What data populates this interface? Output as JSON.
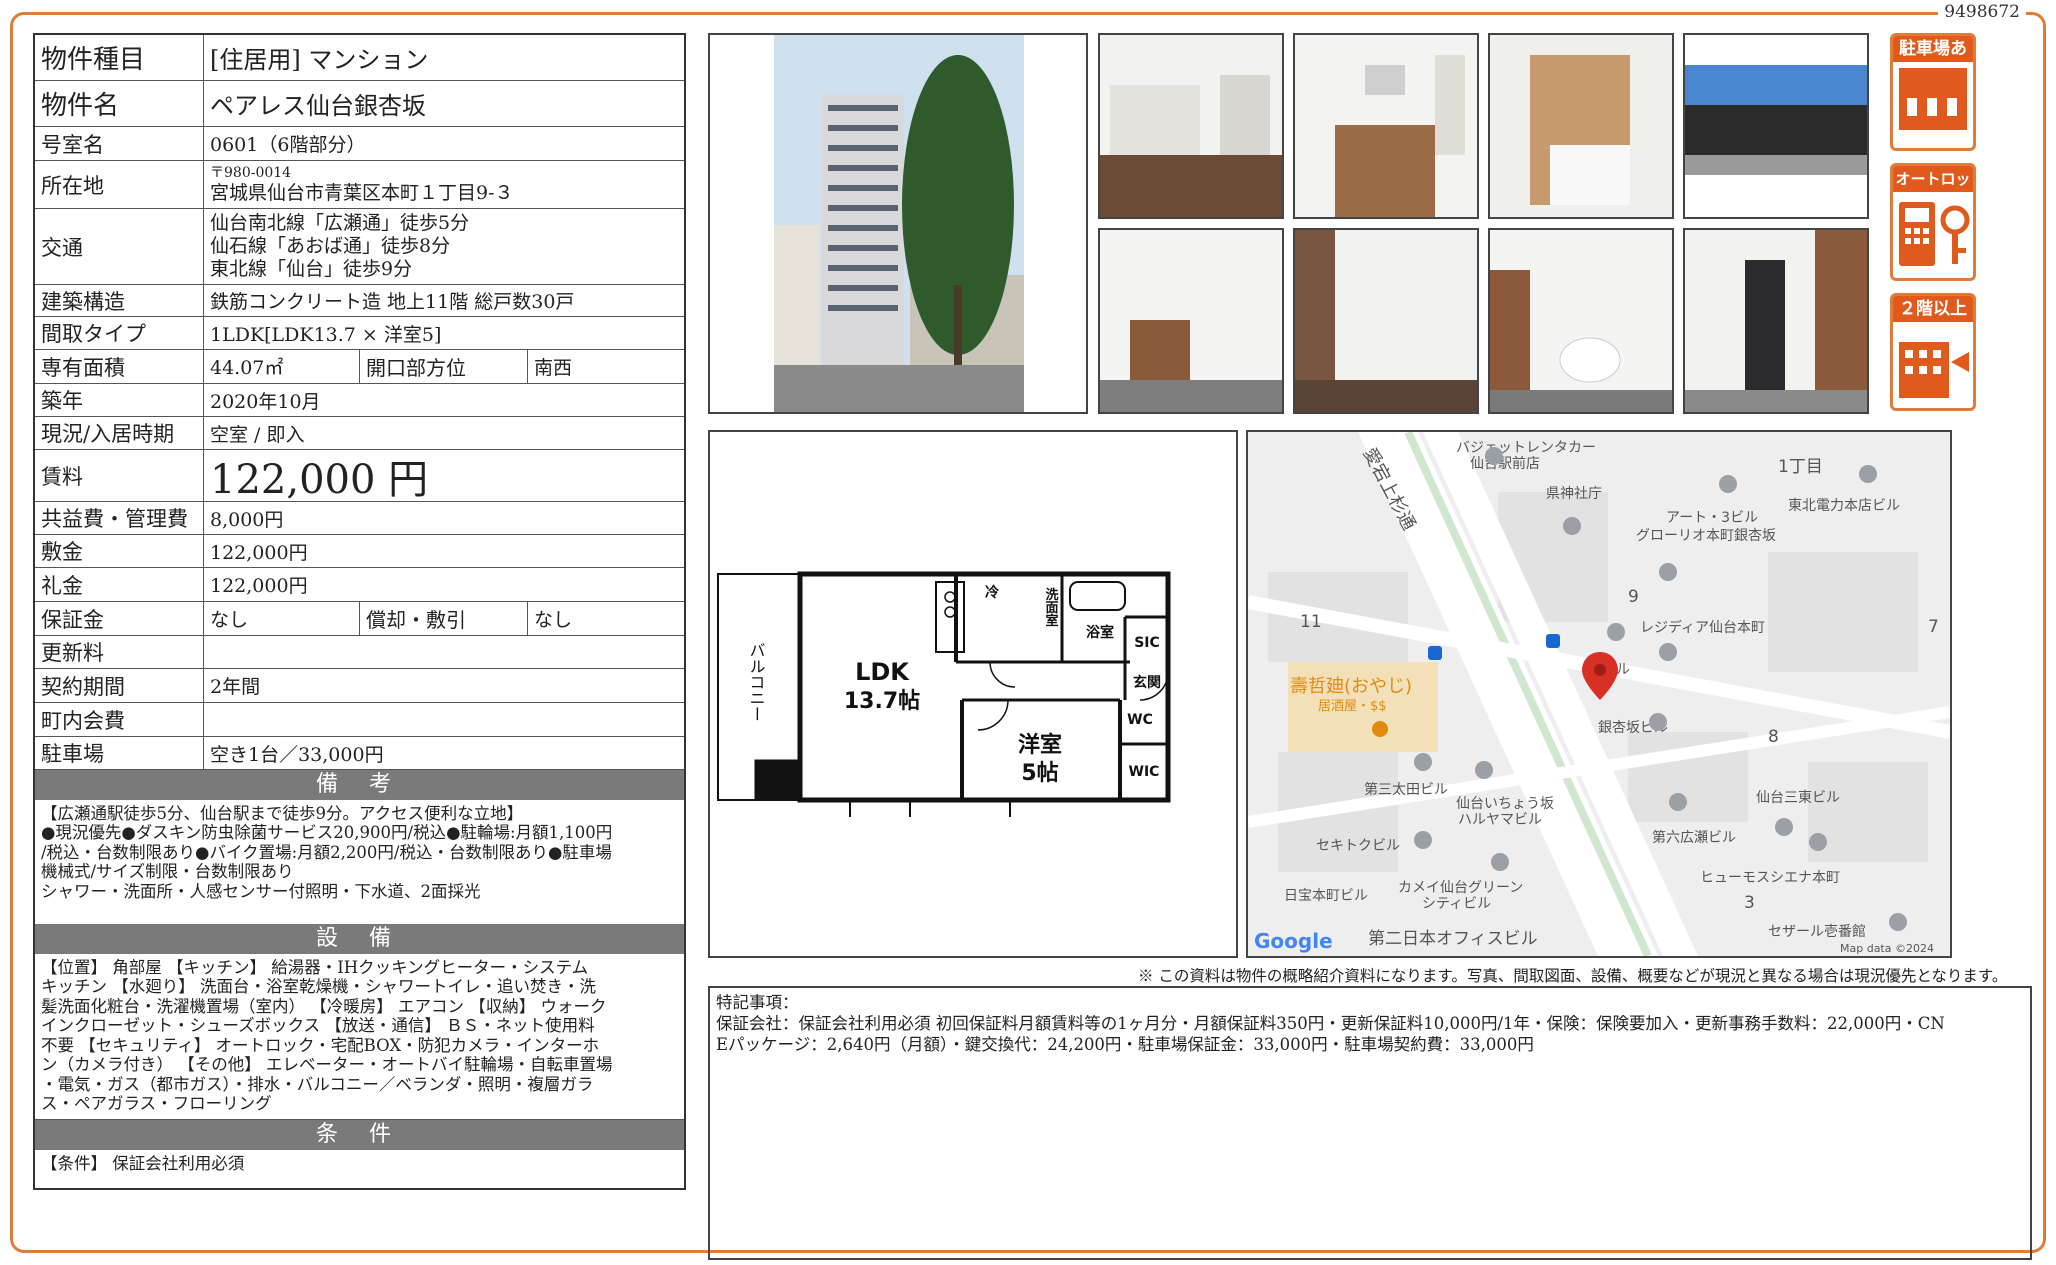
{
  "doc_id": "9498672",
  "property": {
    "type_label": "物件種目",
    "type_value": "[住居用] マンション",
    "name_label": "物件名",
    "name_value": "ペアレス仙台銀杏坂",
    "room_label": "号室名",
    "room_value": "0601（6階部分）",
    "address_label": "所在地",
    "postal": "〒980-0014",
    "address_value": "宮城県仙台市青葉区本町１丁目9-３",
    "transport_label": "交通",
    "transport_lines": [
      "仙台南北線「広瀬通」徒歩5分",
      "仙石線「あおば通」徒歩8分",
      "東北線「仙台」徒歩9分"
    ],
    "structure_label": "建築構造",
    "structure_value": "鉄筋コンクリート造 地上11階 総戸数30戸",
    "layout_label": "間取タイプ",
    "layout_value": "1LDK[LDK13.7 × 洋室5]",
    "area_label": "専有面積",
    "area_value": "44.07㎡",
    "direction_label": "開口部方位",
    "direction_value": "南西",
    "built_label": "築年",
    "built_value": "2020年10月",
    "status_label": "現況/入居時期",
    "status_value": "空室 / 即入",
    "rent_label": "賃料",
    "rent_value": "122,000 円",
    "fee_label": "共益費・管理費",
    "fee_value": "8,000円",
    "deposit_label": "敷金",
    "deposit_value": "122,000円",
    "key_money_label": "礼金",
    "key_money_value": "122,000円",
    "guarantee_label": "保証金",
    "guarantee_value": "なし",
    "amort_label": "償却・敷引",
    "amort_value": "なし",
    "renewal_label": "更新料",
    "renewal_value": "",
    "contract_label": "契約期間",
    "contract_value": "2年間",
    "community_label": "町内会費",
    "community_value": "",
    "parking_label": "駐車場",
    "parking_value": "空き1台／33,000円"
  },
  "remarks": {
    "title": "備 考",
    "lines": [
      "【広瀬通駅徒歩5分、仙台駅まで徒歩9分。アクセス便利な立地】",
      "●現況優先●ダスキン防虫除菌サービス20,900円/税込●駐輪場:月額1,100円",
      "/税込・台数制限あり●バイク置場:月額2,200円/税込・台数制限あり●駐車場",
      "機械式/サイズ制限・台数制限あり",
      "シャワー・洗面所・人感センサー付照明・下水道、2面採光"
    ]
  },
  "equipment": {
    "title": "設 備",
    "lines": [
      "【位置】 角部屋 【キッチン】 給湯器・IHクッキングヒーター・システム",
      "キッチン 【水廻り】 洗面台・浴室乾燥機・シャワートイレ・追い焚き・洗",
      "髪洗面化粧台・洗濯機置場（室内） 【冷暖房】 エアコン 【収納】 ウォーク",
      "インクローゼット・シューズボックス 【放送・通信】 ＢＳ・ネット使用料",
      "不要 【セキュリティ】 オートロック・宅配BOX・防犯カメラ・インターホ",
      "ン（カメラ付き） 【その他】 エレベーター・オートバイ駐輪場・自転車置場",
      "・電気・ガス（都市ガス）・排水・バルコニー／ベランダ・照明・複層ガラ",
      "ス・ペアガラス・フローリング"
    ]
  },
  "conditions": {
    "title": "条 件",
    "lines": [
      "【条件】 保証会社利用必須"
    ]
  },
  "badges": [
    "駐車場あり",
    "オートロック",
    "２階以上"
  ],
  "floorplan": {
    "balcony": "バルコニー",
    "ldk": "LDK",
    "ldk_size": "13.7帖",
    "western": "洋室",
    "western_size": "5帖",
    "fridge": "冷",
    "washroom": "洗面室",
    "bath": "浴室",
    "sic": "SIC",
    "entrance": "玄関",
    "wc": "WC",
    "wic": "WIC"
  },
  "map": {
    "labels": [
      "愛宕上杉通",
      "バジェットレンタカー",
      "仙台駅前店",
      "1丁目",
      "県神社庁",
      "アート・3ビル",
      "東北電力本店ビル",
      "グローリオ本町銀杏坂",
      "9",
      "7",
      "11",
      "レジディア仙台本町",
      "ビル",
      "壽哲廸(おやじ)",
      "居酒屋・$$",
      "銀杏坂ビル",
      "8",
      "第三太田ビル",
      "仙台いちょう坂",
      "ハルヤマビル",
      "仙台三東ビル",
      "第六広瀬ビル",
      "セキトクビル",
      "ヒューモスシエナ本町",
      "日宝本町ビル",
      "カメイ仙台グリーン",
      "シティビル",
      "3",
      "セザール壱番館",
      "第二日本オフィスビル",
      "Google",
      "Map data ©2024"
    ]
  },
  "disclaimer": "※ この資料は物件の概略紹介資料になります。写真、間取図面、設備、概要などが現況と異なる場合は現況優先となります。",
  "special": {
    "title": "特記事項：",
    "line1": "保証会社：保証会社利用必須 初回保証料月額賃料等の1ヶ月分・月額保証料350円・更新保証料10,000円/1年・保険：保険要加入・更新事務手数料：22,000円・CN",
    "line2": "Eパッケージ：2,640円（月額）・鍵交換代：24,200円・駐車場保証金：33,000円・駐車場契約費：33,000円"
  }
}
